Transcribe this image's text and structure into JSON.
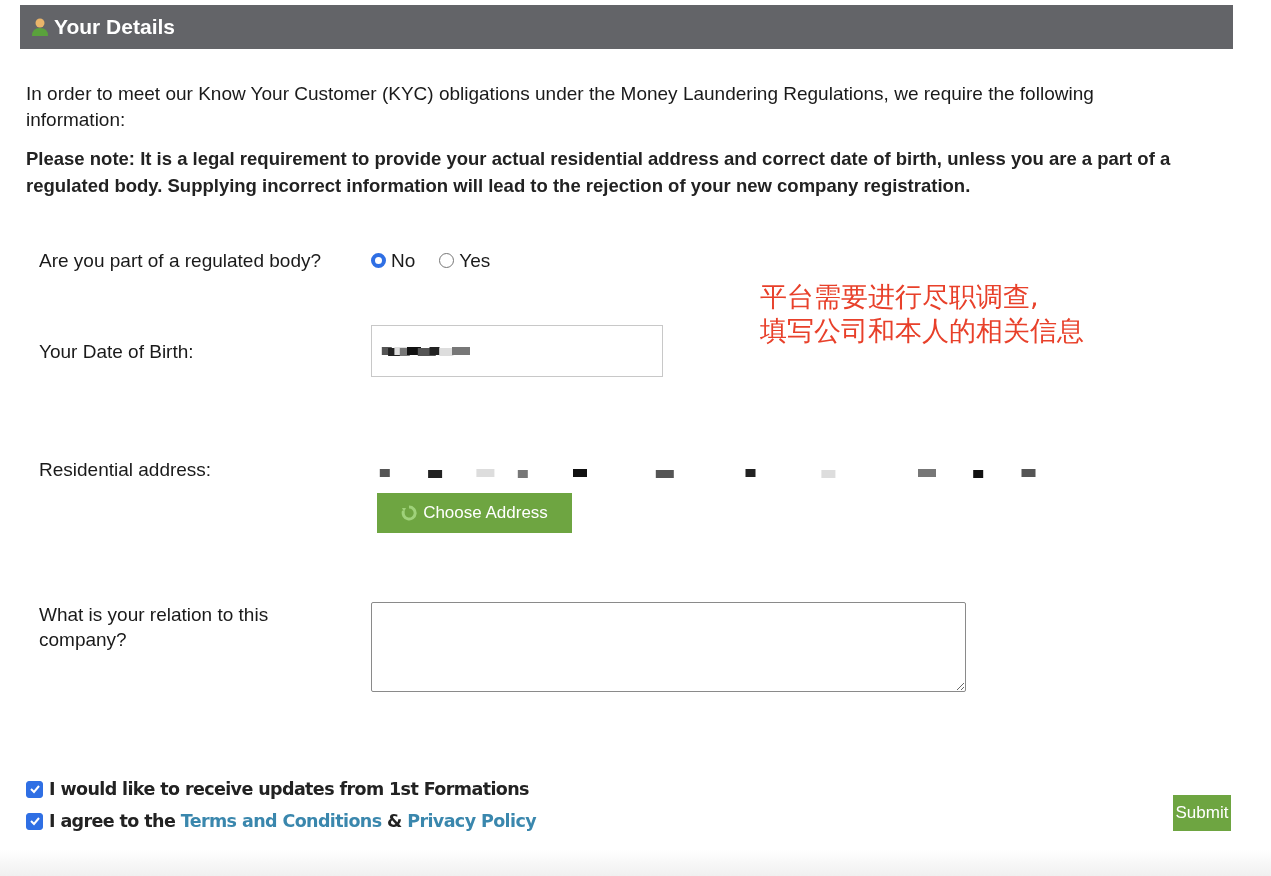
{
  "panel": {
    "title": "Your Details"
  },
  "intro": "In order to meet our Know Your Customer (KYC) obligations under the Money Laundering Regulations, we require the following information:",
  "note": "Please note: It is a legal requirement to provide your actual residential address and correct date of birth, unless you are a part of a regulated body. Supplying incorrect information will lead to the rejection of your new company registration.",
  "regulated": {
    "label": "Are you part of a regulated body?",
    "options": [
      {
        "label": "No",
        "selected": true
      },
      {
        "label": "Yes",
        "selected": false
      }
    ]
  },
  "annotation": [
    "平台需要进行尽职调查,",
    "填写公司和本人的相关信息"
  ],
  "dob": {
    "label": "Your Date of Birth:"
  },
  "address": {
    "label": "Residential address:",
    "button": "Choose Address"
  },
  "relation": {
    "label": "What is your relation to this company?"
  },
  "consents": [
    {
      "checked": true,
      "parts": [
        {
          "kind": "text",
          "text": "I would like to receive updates from 1st Formations"
        }
      ]
    },
    {
      "checked": true,
      "parts": [
        {
          "kind": "text",
          "text": "I agree to the "
        },
        {
          "kind": "link",
          "text": "Terms and Conditions"
        },
        {
          "kind": "text",
          "text": " & "
        },
        {
          "kind": "link",
          "text": "Privacy Policy"
        }
      ]
    }
  ],
  "submit": "Submit"
}
